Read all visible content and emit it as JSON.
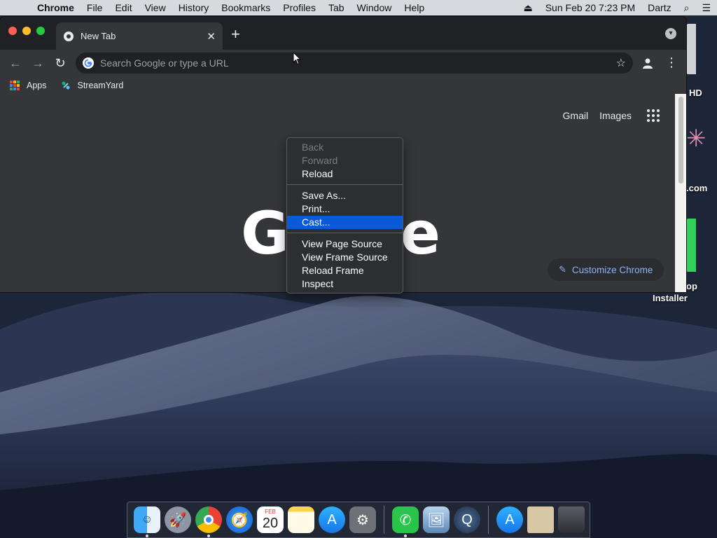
{
  "menubar": {
    "apple_icon": "apple-icon",
    "items": [
      "Chrome",
      "File",
      "Edit",
      "View",
      "History",
      "Bookmarks",
      "Profiles",
      "Tab",
      "Window",
      "Help"
    ],
    "clock": "Sun Feb 20  7:23 PM",
    "user": "Dartz"
  },
  "browser": {
    "tab_title": "New Tab",
    "omnibox_placeholder": "Search Google or type a URL",
    "bookmarks": [
      {
        "label": "Apps",
        "icon": "apps-grid-icon"
      },
      {
        "label": "StreamYard",
        "icon": "streamyard-icon"
      }
    ]
  },
  "newtab_page": {
    "links": [
      "Gmail",
      "Images"
    ],
    "logo_left": "G",
    "logo_right": "e",
    "customize_label": "Customize Chrome"
  },
  "context_menu": {
    "groups": [
      [
        {
          "label": "Back",
          "enabled": false
        },
        {
          "label": "Forward",
          "enabled": false
        },
        {
          "label": "Reload",
          "enabled": true
        }
      ],
      [
        {
          "label": "Save As...",
          "enabled": true
        },
        {
          "label": "Print...",
          "enabled": true
        },
        {
          "label": "Cast...",
          "enabled": true,
          "selected": true
        }
      ],
      [
        {
          "label": "View Page Source",
          "enabled": true
        },
        {
          "label": "View Frame Source",
          "enabled": true
        },
        {
          "label": "Reload Frame",
          "enabled": true
        },
        {
          "label": "Inspect",
          "enabled": true
        }
      ]
    ]
  },
  "desktop_labels": [
    "HD",
    ".com",
    "op",
    "Installer"
  ],
  "dock": {
    "calendar_month": "FEB",
    "calendar_day": "20",
    "apps": [
      "finder",
      "launchpad",
      "chrome",
      "safari",
      "calendar",
      "notes",
      "app-store",
      "system-preferences",
      "whatsapp",
      "preview",
      "quicktime",
      "app-store-2",
      "image-file",
      "trash"
    ]
  },
  "colors": {
    "menu_highlight": "#0a59d9",
    "link_blue": "#8ab4f8"
  }
}
